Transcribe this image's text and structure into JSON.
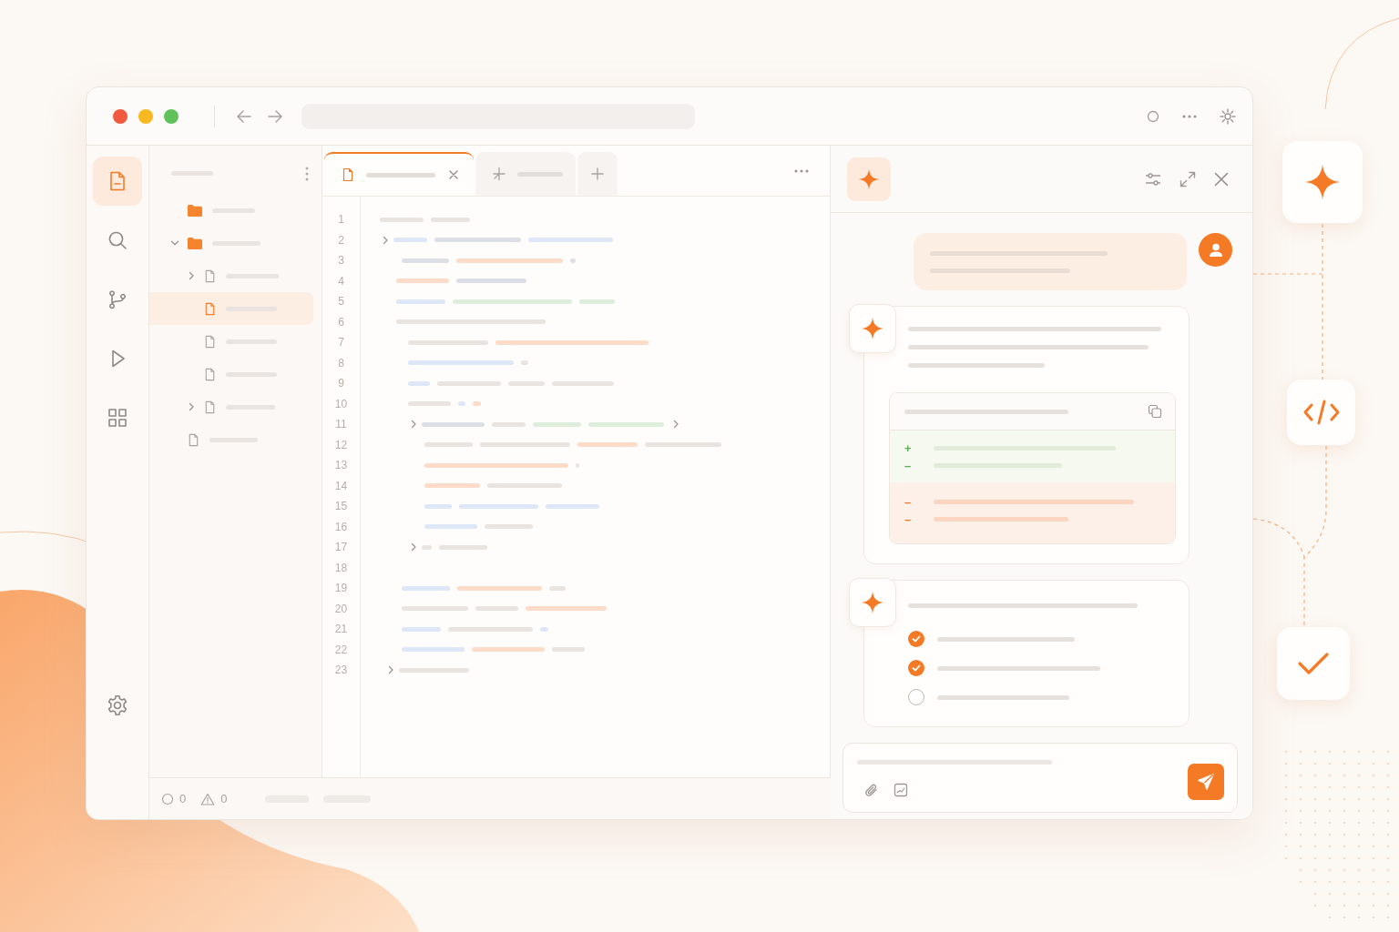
{
  "title_bar": {
    "traffic_lights": [
      {
        "color": "#f05a3f"
      },
      {
        "color": "#f8b81f"
      },
      {
        "color": "#62c25a"
      }
    ]
  },
  "activity_bar": [
    {
      "kind": "files",
      "selected": true
    },
    {
      "kind": "search",
      "selected": false
    },
    {
      "kind": "branch",
      "selected": false
    },
    {
      "kind": "run",
      "selected": false
    },
    {
      "kind": "extensions",
      "selected": false
    }
  ],
  "explorer": {
    "items": [
      {
        "kind": "folder",
        "selected": false
      },
      {
        "kind": "folder",
        "expanded": true,
        "selected": false,
        "children": [
          {
            "kind": "file",
            "expanded": false,
            "selected": false
          },
          {
            "kind": "file",
            "selected": true
          },
          {
            "kind": "file",
            "selected": false
          },
          {
            "kind": "file",
            "selected": false
          },
          {
            "kind": "file",
            "expanded": false,
            "selected": false
          }
        ]
      },
      {
        "kind": "file",
        "selected": false
      }
    ]
  },
  "editor": {
    "tabs": [
      {
        "kind": "file",
        "selected": true
      },
      {
        "kind": "pinned",
        "selected": false
      }
    ],
    "lines": [
      {
        "number": "1"
      },
      {
        "number": "2",
        "foldable": true
      },
      {
        "number": "3"
      },
      {
        "number": "4"
      },
      {
        "number": "5"
      },
      {
        "number": "6"
      },
      {
        "number": "7"
      },
      {
        "number": "8"
      },
      {
        "number": "9"
      },
      {
        "number": "10"
      },
      {
        "number": "11",
        "foldable": true
      },
      {
        "number": "12"
      },
      {
        "number": "13"
      },
      {
        "number": "14"
      },
      {
        "number": "15"
      },
      {
        "number": "16"
      },
      {
        "number": "17",
        "foldable": true
      },
      {
        "number": "18"
      },
      {
        "number": "19"
      },
      {
        "number": "20"
      },
      {
        "number": "21"
      },
      {
        "number": "22"
      },
      {
        "number": "23",
        "foldable": true
      }
    ]
  },
  "chat": {
    "messages": [
      {
        "kind": "user"
      },
      {
        "kind": "diff",
        "diff": [
          {
            "sign": "+",
            "kind": "added"
          },
          {
            "sign": "–",
            "kind": "added"
          },
          {
            "sign": "–",
            "kind": "removed"
          },
          {
            "sign": "–",
            "kind": "removed"
          }
        ]
      },
      {
        "kind": "tasks",
        "tasks": [
          {
            "checked": true
          },
          {
            "checked": true
          },
          {
            "checked": false
          }
        ]
      }
    ]
  },
  "status_bar": {
    "errors": "0",
    "warnings": "0"
  },
  "flow": [
    {
      "kind": "sparkle"
    },
    {
      "kind": "code"
    },
    {
      "kind": "check"
    }
  ]
}
